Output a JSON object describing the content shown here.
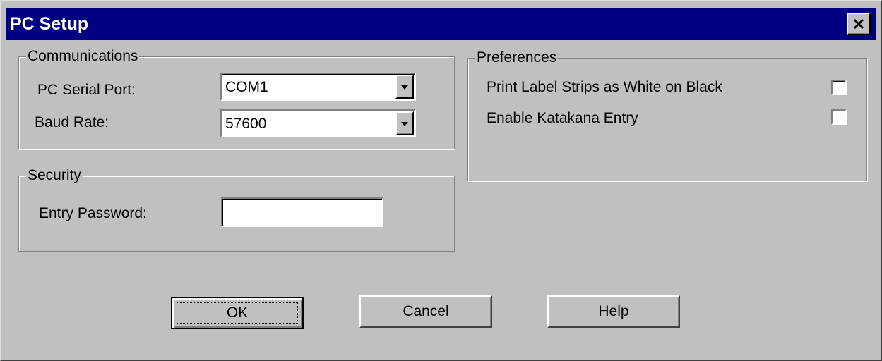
{
  "window": {
    "title": "PC Setup",
    "close_icon": "close-x-icon",
    "titlebar_color": "#000080"
  },
  "communications": {
    "group_label": "Communications",
    "serial_port_label": "PC Serial Port:",
    "serial_port_value": "COM1",
    "baud_rate_label": "Baud Rate:",
    "baud_rate_value": "57600"
  },
  "security": {
    "group_label": "Security",
    "password_label": "Entry Password:",
    "password_value": ""
  },
  "preferences": {
    "group_label": "Preferences",
    "print_label_strips_label": "Print Label Strips as White on Black",
    "print_label_strips_checked": false,
    "katakana_label": "Enable Katakana Entry",
    "katakana_checked": false
  },
  "buttons": {
    "ok_label": "OK",
    "cancel_label": "Cancel",
    "help_label": "Help"
  }
}
